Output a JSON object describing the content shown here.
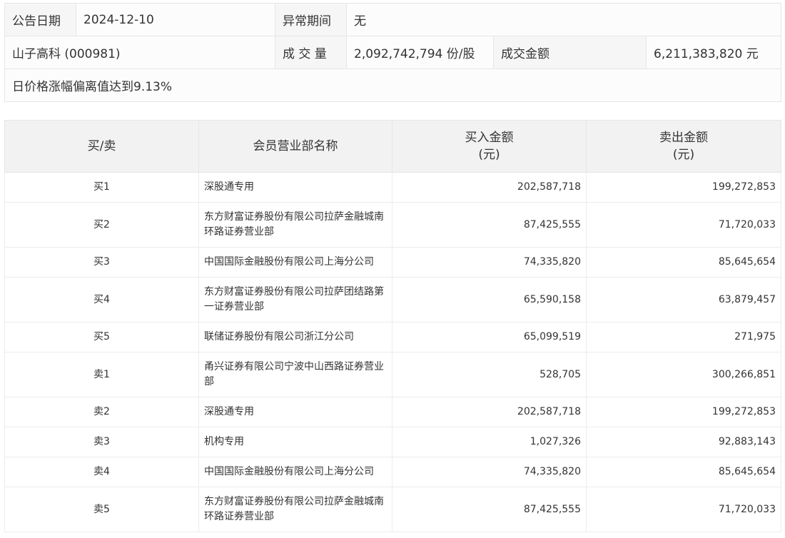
{
  "info": {
    "date_label": "公告日期",
    "date_value": "2024-12-10",
    "period_label": "异常期间",
    "period_value": "无",
    "stock": "山子高科 (000981)",
    "volume_label": "成 交 量",
    "volume_value": "2,092,742,794 份/股",
    "amount_label": "成交金额",
    "amount_value": "6,211,383,820 元",
    "reason": "日价格涨幅偏离值达到9.13%"
  },
  "table": {
    "headers": {
      "side": "买/卖",
      "dept": "会员营业部名称",
      "buy_line1": "买入金额",
      "buy_line2": "(元)",
      "sell_line1": "卖出金额",
      "sell_line2": "(元)"
    },
    "rows": [
      {
        "side": "买1",
        "dept": "深股通专用",
        "buy": "202,587,718",
        "sell": "199,272,853"
      },
      {
        "side": "买2",
        "dept": "东方财富证券股份有限公司拉萨金融城南环路证券营业部",
        "buy": "87,425,555",
        "sell": "71,720,033"
      },
      {
        "side": "买3",
        "dept": "中国国际金融股份有限公司上海分公司",
        "buy": "74,335,820",
        "sell": "85,645,654"
      },
      {
        "side": "买4",
        "dept": "东方财富证券股份有限公司拉萨团结路第一证券营业部",
        "buy": "65,590,158",
        "sell": "63,879,457"
      },
      {
        "side": "买5",
        "dept": "联储证券股份有限公司浙江分公司",
        "buy": "65,099,519",
        "sell": "271,975"
      },
      {
        "side": "卖1",
        "dept": "甬兴证券有限公司宁波中山西路证券营业部",
        "buy": "528,705",
        "sell": "300,266,851"
      },
      {
        "side": "卖2",
        "dept": "深股通专用",
        "buy": "202,587,718",
        "sell": "199,272,853"
      },
      {
        "side": "卖3",
        "dept": "机构专用",
        "buy": "1,027,326",
        "sell": "92,883,143"
      },
      {
        "side": "卖4",
        "dept": "中国国际金融股份有限公司上海分公司",
        "buy": "74,335,820",
        "sell": "85,645,654"
      },
      {
        "side": "卖5",
        "dept": "东方财富证券股份有限公司拉萨金融城南环路证券营业部",
        "buy": "87,425,555",
        "sell": "71,720,033"
      }
    ]
  }
}
